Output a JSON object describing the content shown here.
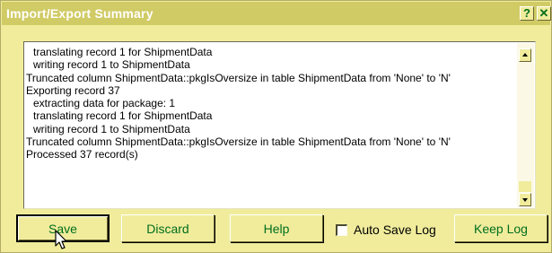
{
  "window": {
    "title": "Import/Export Summary",
    "help_glyph": "?",
    "close_glyph": "✕"
  },
  "log": {
    "lines": [
      "translating record 1 for ShipmentData",
      "writing record 1 to ShipmentData",
      "Truncated column ShipmentData::pkgIsOversize in table ShipmentData from 'None' to 'N'",
      "Exporting record 37",
      "extracting data for package: 1",
      "translating record 1 for ShipmentData",
      "writing record 1 to ShipmentData",
      "Truncated column ShipmentData::pkgIsOversize in table ShipmentData from 'None' to 'N'",
      "Processed 37 record(s)"
    ]
  },
  "buttons": {
    "save": "Save",
    "discard": "Discard",
    "help": "Help",
    "keep_log": "Keep Log"
  },
  "auto_save_log": {
    "label": "Auto Save Log",
    "checked": false
  },
  "colors": {
    "title_bar": "#d1cb66",
    "window_bg": "#f0ec9c",
    "button_text": "#006e1c"
  },
  "icons": {
    "cursor": "arrow-pointer-icon",
    "scroll_up": "triangle-up-icon",
    "scroll_down": "triangle-down-icon"
  }
}
